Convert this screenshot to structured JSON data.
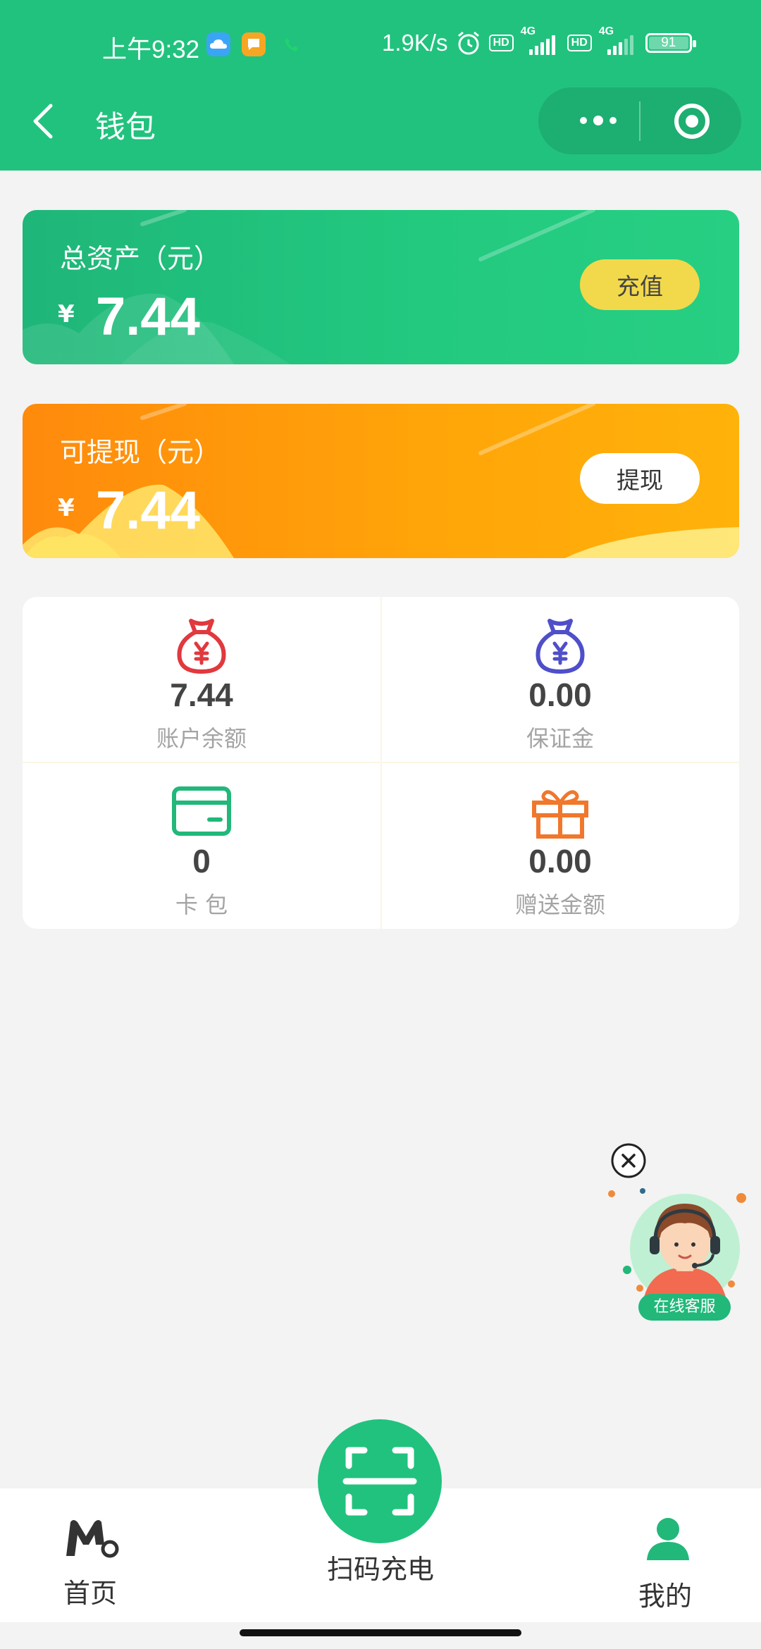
{
  "status_bar": {
    "time": "上午9:32",
    "network_speed": "1.9K/s",
    "sim1_badge": "HD",
    "sim1_network": "4G",
    "sim2_badge": "HD",
    "sim2_network": "4G",
    "battery_level": "91",
    "icons": [
      "cloud-app-icon",
      "message-app-icon",
      "phone-app-icon",
      "alarm-icon"
    ]
  },
  "title_bar": {
    "title": "钱包",
    "back_icon": "chevron-left-icon",
    "more_icon": "more-dots-icon",
    "close_icon": "target-close-icon"
  },
  "total_assets": {
    "label": "总资产（元）",
    "currency": "¥",
    "amount": "7.44",
    "button": "充值"
  },
  "withdrawable": {
    "label": "可提现（元）",
    "currency": "¥",
    "amount": "7.44",
    "button": "提现"
  },
  "stats": [
    {
      "value": "7.44",
      "label": "账户余额",
      "icon": "money-bag-icon",
      "color": "#e0393e"
    },
    {
      "value": "0.00",
      "label": "保证金",
      "icon": "money-bag-icon",
      "color": "#4f4fc9"
    },
    {
      "value": "0",
      "label": "卡 包",
      "icon": "card-icon",
      "color": "#21b87a"
    },
    {
      "value": "0.00",
      "label": "赠送金额",
      "icon": "gift-icon",
      "color": "#f0772c"
    }
  ],
  "customer_service": {
    "label": "在线客服",
    "close_icon": "close-circle-icon"
  },
  "bottom_nav": {
    "home": "首页",
    "scan": "扫码充电",
    "mine": "我的"
  },
  "colors": {
    "brand_green": "#21c27e",
    "orange": "#ffa409",
    "recharge_yellow": "#f2d94b"
  }
}
